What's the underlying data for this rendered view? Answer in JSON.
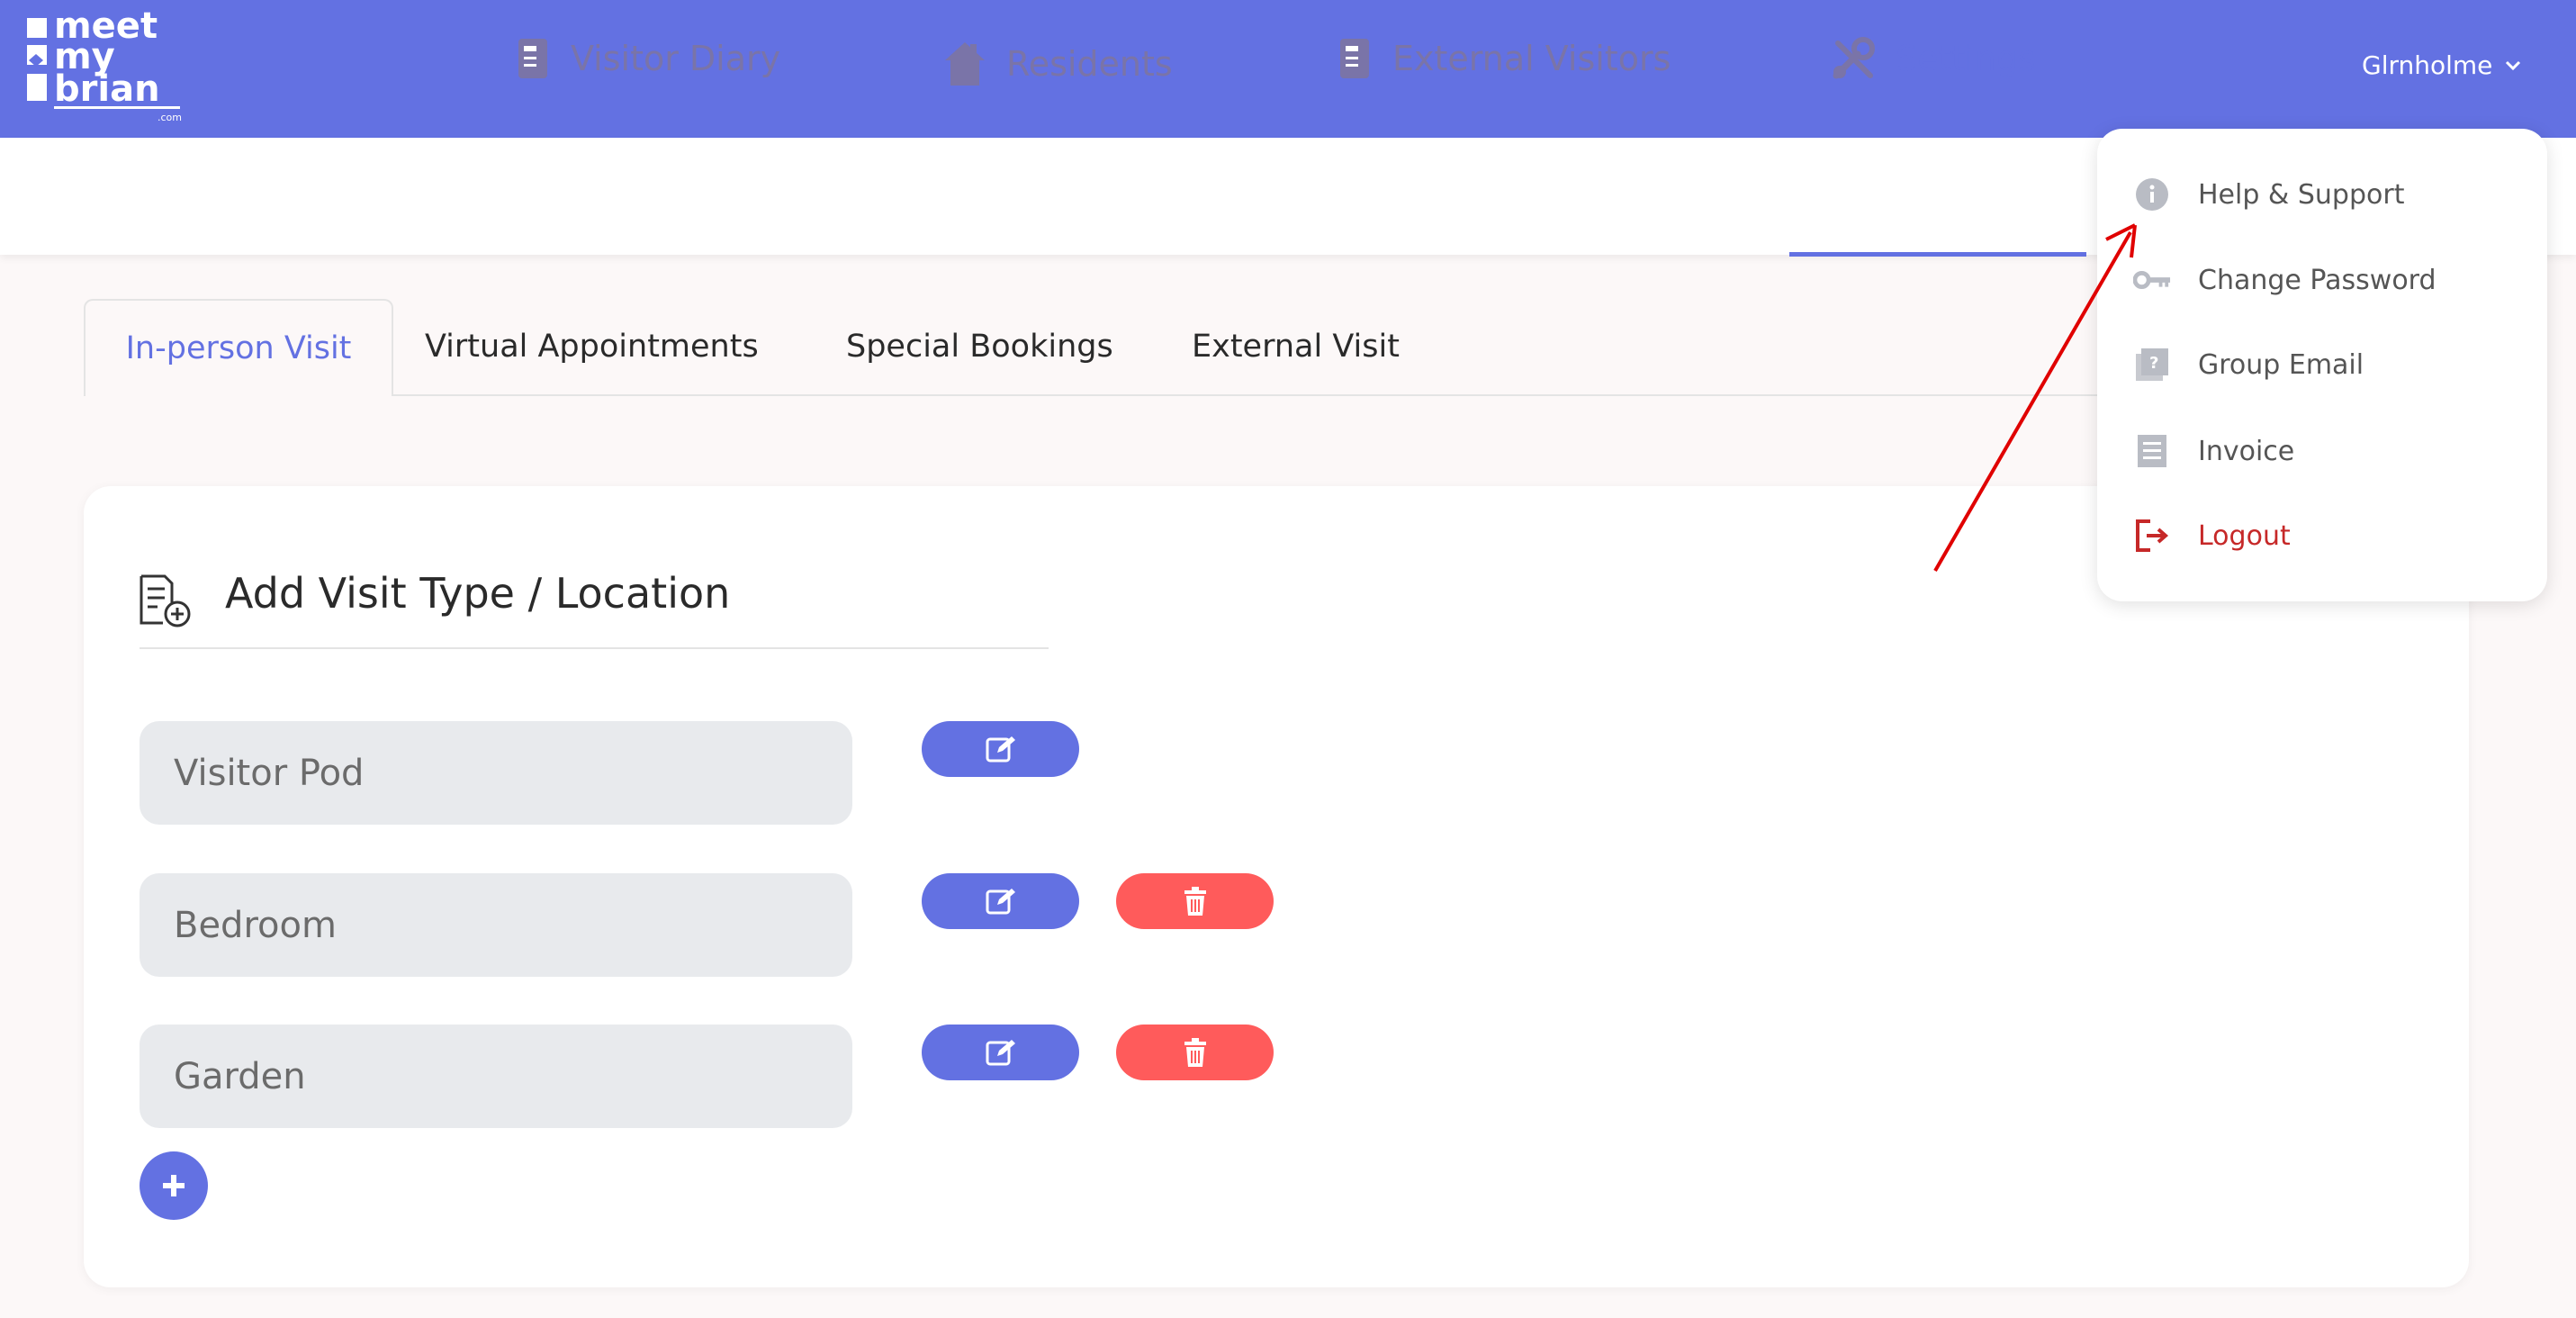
{
  "header": {
    "logo_text": [
      "meet",
      "my",
      "brian",
      ".com"
    ],
    "username": "Glrnholme"
  },
  "nav": {
    "items": [
      {
        "label": "Visitor Diary",
        "icon": "diary-icon"
      },
      {
        "label": "Residents",
        "icon": "house-icon"
      },
      {
        "label": "External Visitors",
        "icon": "diary-icon"
      },
      {
        "label": "Settings",
        "icon": "tools-icon",
        "active": true
      }
    ]
  },
  "tabs": [
    {
      "label": "In-person Visit",
      "active": true
    },
    {
      "label": "Virtual Appointments"
    },
    {
      "label": "Special Bookings"
    },
    {
      "label": "External Visit"
    }
  ],
  "card": {
    "title": "Add Visit Type / Location",
    "locations": [
      "Visitor Pod",
      "Bedroom",
      "Garden"
    ]
  },
  "dropdown": {
    "items": [
      {
        "label": "Help & Support",
        "icon": "info-icon"
      },
      {
        "label": "Change Password",
        "icon": "key-icon"
      },
      {
        "label": "Group Email",
        "icon": "question-book-icon"
      },
      {
        "label": "Invoice",
        "icon": "document-icon"
      },
      {
        "label": "Logout",
        "icon": "logout-icon"
      }
    ]
  },
  "colors": {
    "brand": "#6371e2",
    "danger": "#ff5b5b",
    "logout": "#c62828",
    "annotation_arrow": "#e00000"
  }
}
